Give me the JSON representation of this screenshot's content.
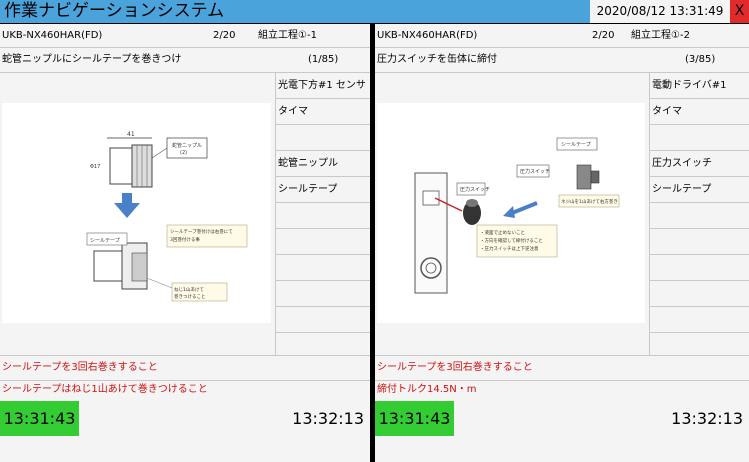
{
  "app": {
    "title": "作業ナビゲーションシステム",
    "datetime": "2020/08/12 13:31:49",
    "close_label": "X"
  },
  "left": {
    "model": "UKB-NX460HAR(FD)",
    "count": "2/20",
    "process": "組立工程①-1",
    "instruction": "蛇管ニップルにシールテープを巻きつけ",
    "step_progress": "(1/85)",
    "parts": [
      "光電下方#1 センサ",
      "タイマ",
      "",
      "蛇管ニップル",
      "シールテープ",
      "",
      "",
      "",
      "",
      "",
      ""
    ],
    "note1": "シールテープを3回右巻きすること",
    "note2": "シールテープはねじ1山あけて巻きつけること",
    "time_start": "13:31:43",
    "time_end": "13:32:13"
  },
  "right": {
    "model": "UKB-NX460HAR(FD)",
    "count": "2/20",
    "process": "組立工程①-2",
    "instruction": "圧力スイッチを缶体に締付",
    "step_progress": "(3/85)",
    "parts": [
      "電動ドライバ#1",
      "タイマ",
      "",
      "圧力スイッチ",
      "シールテープ",
      "",
      "",
      "",
      "",
      "",
      ""
    ],
    "note1": "シールテープを3回右巻きすること",
    "note2": "締付トルク14.5N・m",
    "time_start": "13:31:43",
    "time_end": "13:32:13"
  }
}
